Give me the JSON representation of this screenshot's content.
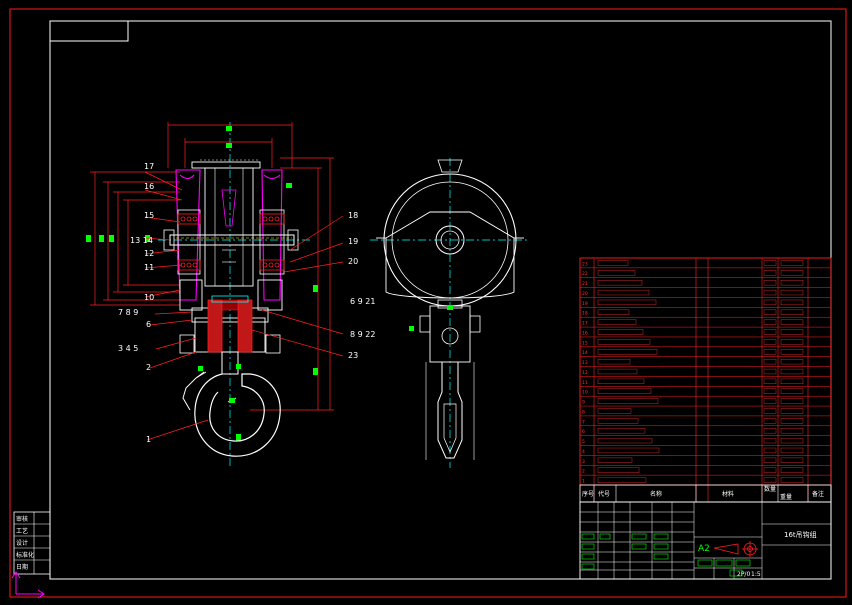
{
  "colors": {
    "background": "#000000",
    "outer_frame": "#ff1a1a",
    "inner_frame": "#ffffff",
    "part_lines": "#ffffff",
    "centerlines": "#00ffff",
    "dimensions": "#ff2020",
    "leaders": "#ff2020",
    "sheave": "#ff00ff",
    "bearing": "#ff2020",
    "dim_text": "#00ff00",
    "table_lines": "#ff2020",
    "table_text": "#ff3030"
  },
  "callouts": {
    "c1": "1",
    "c2": "2",
    "c345": "3  4  5",
    "c6": "6",
    "c789": "7  8  9",
    "c10": "10",
    "c11": "11",
    "c12": "12",
    "c1314": "13  14",
    "c15": "15",
    "c16": "16",
    "c17": "17",
    "c18": "18",
    "c19": "19",
    "c20": "20",
    "c6921": "6  9  21",
    "c8922": "8  9  22",
    "c23": "23"
  },
  "title_block": {
    "scale_mark": "A2",
    "drawing_title": "16t吊钩组",
    "scale": "1:5",
    "sheet": "2P/0"
  },
  "table_header": {
    "col_no": "序号",
    "col_code": "代号",
    "col_name": "名称",
    "col_qty": "数量",
    "col_material": "材料",
    "col_weight": "重量",
    "col_note": "备注"
  },
  "revision_block": {
    "rows": [
      "审核",
      "工艺",
      "设计",
      "标准化",
      "日期"
    ]
  }
}
